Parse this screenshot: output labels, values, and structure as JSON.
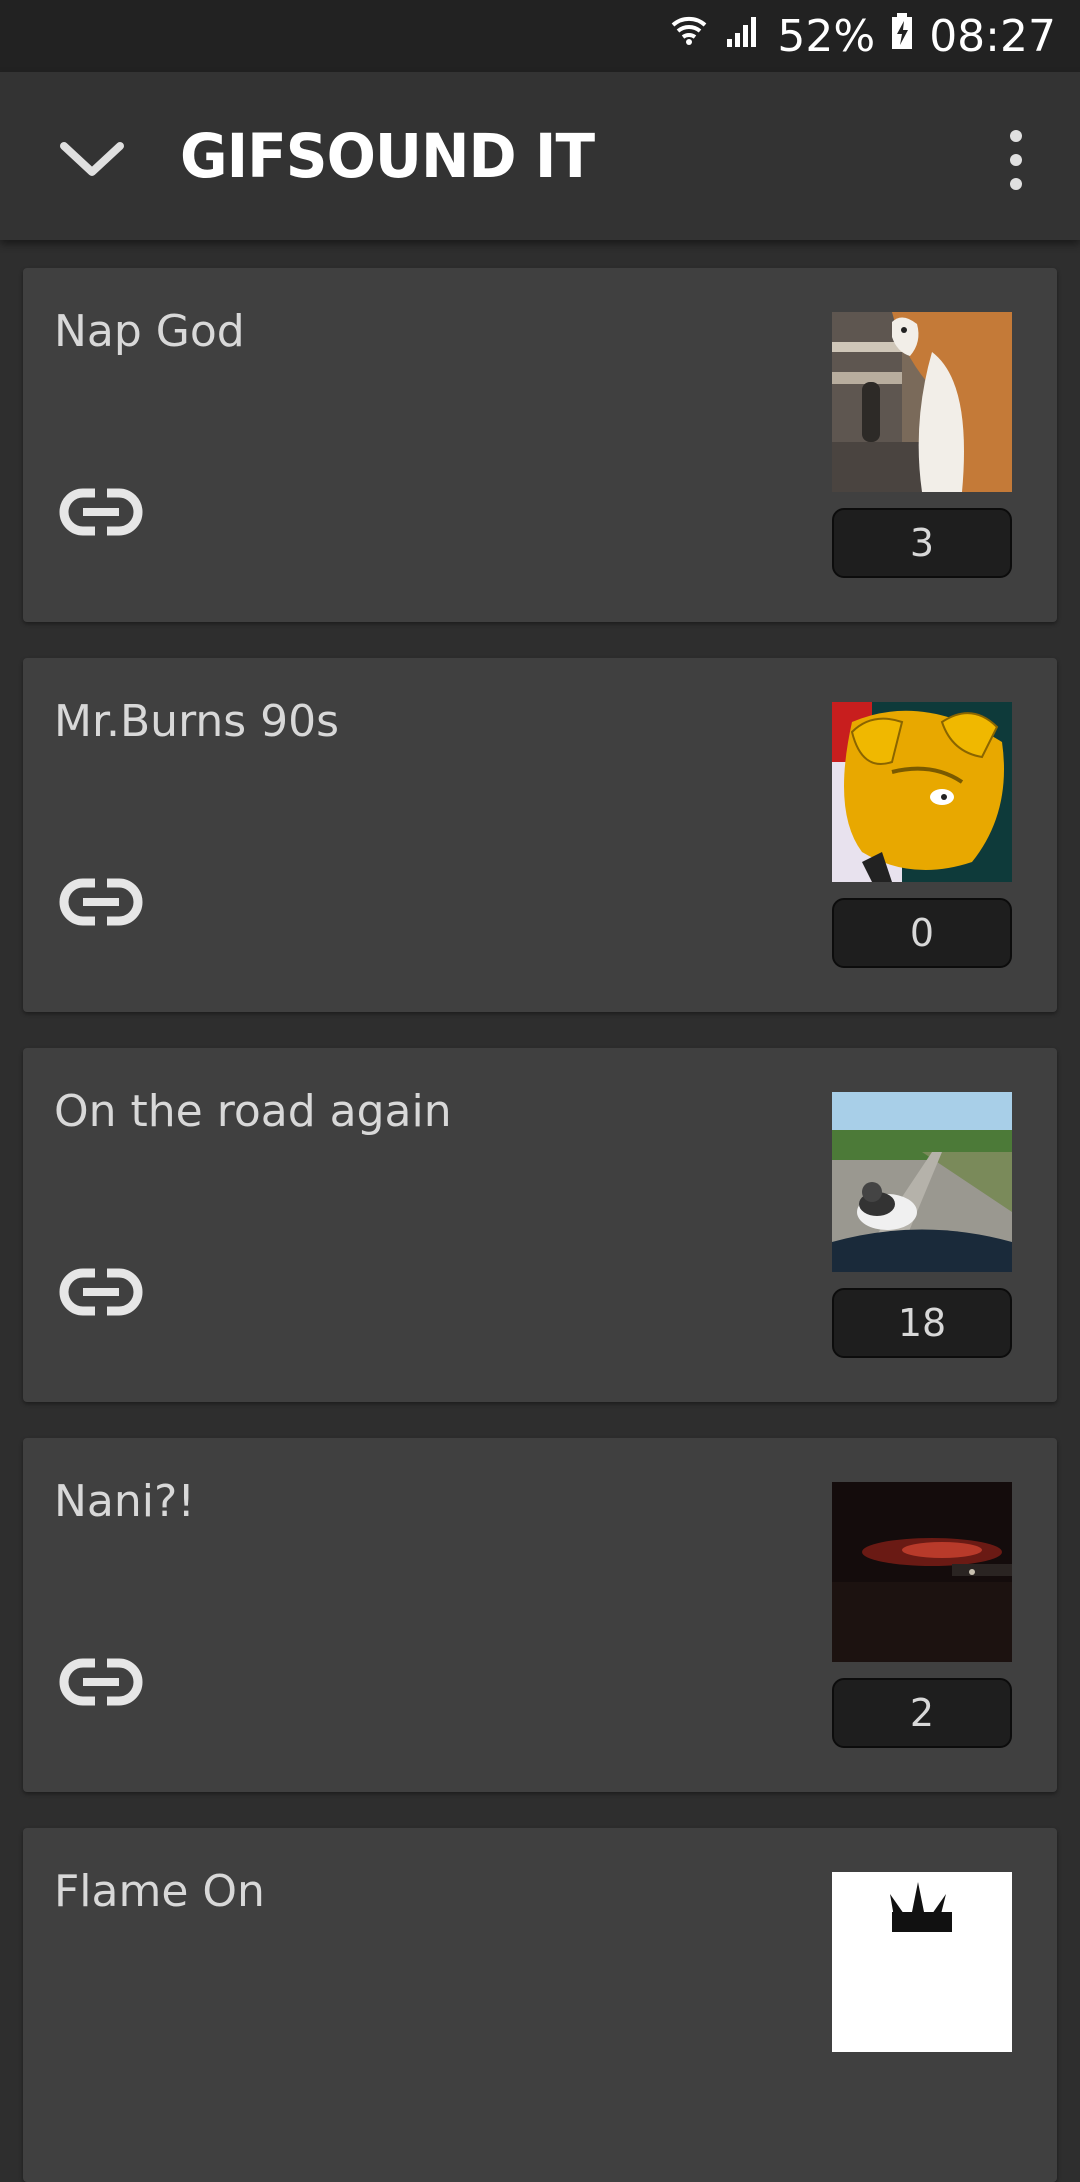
{
  "status_bar": {
    "battery": "52%",
    "time": "08:27",
    "icons": [
      "wifi-icon",
      "signal-icon",
      "battery-icon"
    ]
  },
  "app_bar": {
    "title": "GIFSOUND IT",
    "icons": [
      "chevron-down-icon",
      "overflow-menu-icon"
    ]
  },
  "cards": [
    {
      "title": "Nap God",
      "count": "3",
      "thumb": "cat-thumbnail"
    },
    {
      "title": "Mr.Burns 90s",
      "count": "0",
      "thumb": "mr-burns-thumbnail"
    },
    {
      "title": "On the road again",
      "count": "18",
      "thumb": "road-cat-thumbnail"
    },
    {
      "title": "Nani?!",
      "count": "2",
      "thumb": "night-scene-thumbnail"
    },
    {
      "title": "Flame On",
      "count": "",
      "thumb": "flame-thumbnail"
    }
  ],
  "colors": {
    "background": "#2e2e2e",
    "card": "#404040",
    "app_bar": "#333333",
    "status_bar": "#222222",
    "text": "#d8d8d8"
  }
}
